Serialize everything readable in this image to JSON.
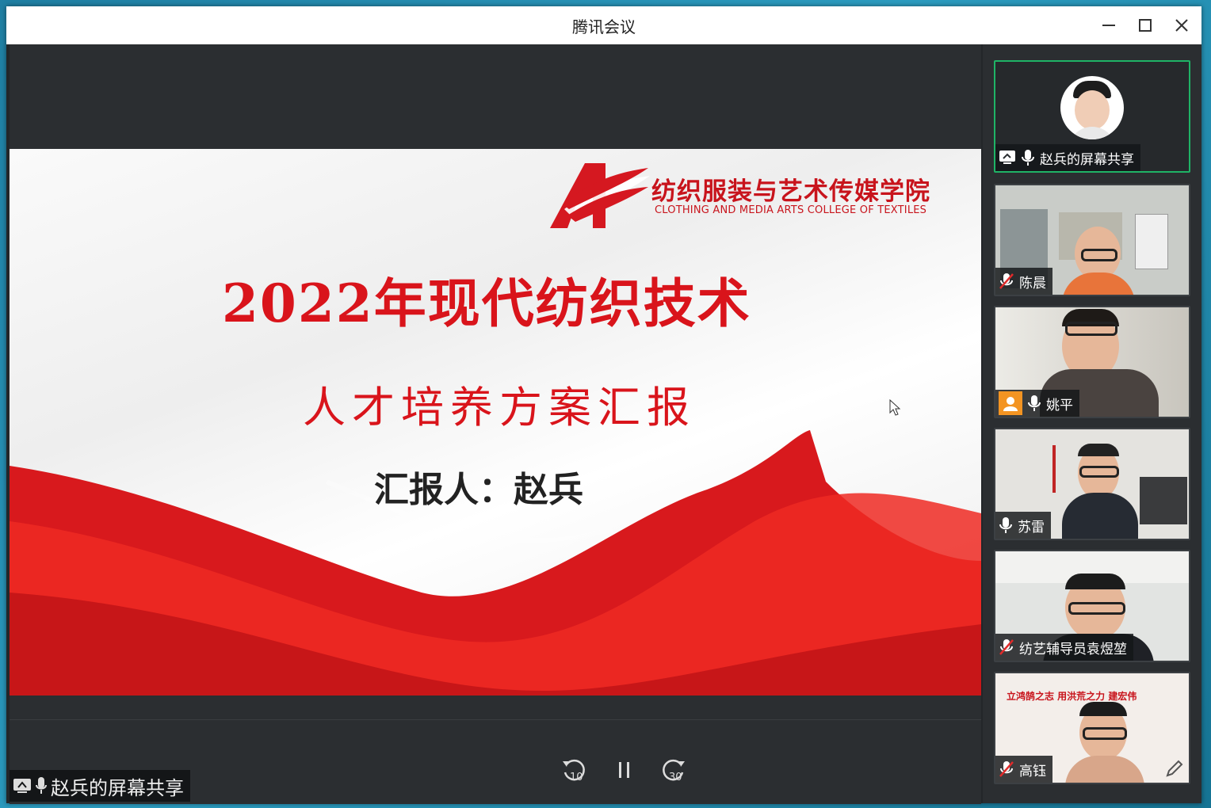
{
  "window": {
    "title": "腾讯会议",
    "controls": [
      "minimize-icon",
      "maximize-icon",
      "close-icon"
    ]
  },
  "slide": {
    "logo_cn": "纺织服装与艺术传媒学院",
    "logo_en": "CLOTHING AND MEDIA ARTS COLLEGE OF TEXTILES",
    "title": "2022年现代纺织技术",
    "subtitle": "人才培养方案汇报",
    "reporter": "汇报人：赵兵",
    "tools": [
      "prev-icon",
      "play-icon",
      "pen-icon",
      "focus-icon",
      "camera-icon",
      "comment-icon",
      "more-icon"
    ]
  },
  "share_label": "赵兵的屏幕共享",
  "playback": {
    "rewind_seconds": "10",
    "forward_seconds": "30"
  },
  "participants": [
    {
      "name": "赵兵的屏幕共享",
      "mic": "on",
      "active": true
    },
    {
      "name": "陈晨",
      "mic": "muted"
    },
    {
      "name": "姚平",
      "mic": "on",
      "avatar_badge": true
    },
    {
      "name": "苏雷",
      "mic": "on"
    },
    {
      "name": "纺艺辅导员袁煜堃",
      "mic": "muted"
    },
    {
      "name": "高钰",
      "mic": "muted",
      "banner_text": "立鸿鹄之志  用洪荒之力  建宏伟"
    }
  ],
  "colors": {
    "accent_red": "#d9141b",
    "active_border": "#1fb366",
    "badge_orange": "#f39422"
  }
}
